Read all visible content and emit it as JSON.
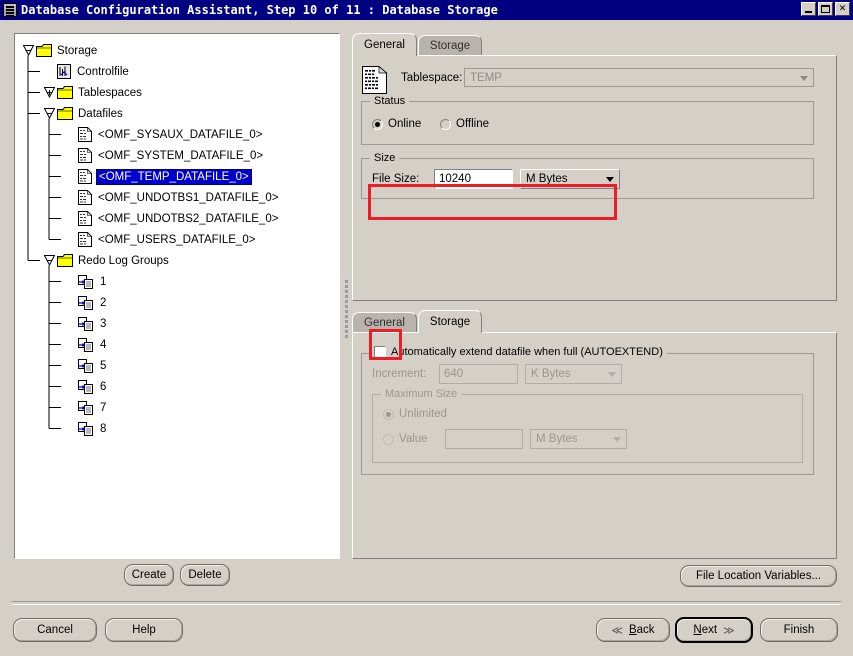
{
  "window": {
    "title": "Database Configuration Assistant, Step 10 of 11 : Database Storage",
    "icon": "database-icon",
    "minimize_label": "_",
    "maximize_label": "",
    "close_label": "✕"
  },
  "tree": {
    "nodes": [
      {
        "label": "Storage",
        "depth": 0,
        "icon": "folder-icon",
        "toggle": "minus",
        "selected": false
      },
      {
        "label": "Controlfile",
        "depth": 1,
        "icon": "controlfile-icon",
        "toggle": "none",
        "selected": false
      },
      {
        "label": "Tablespaces",
        "depth": 1,
        "icon": "folder-icon",
        "toggle": "plus",
        "selected": false
      },
      {
        "label": "Datafiles",
        "depth": 1,
        "icon": "folder-icon",
        "toggle": "minus",
        "selected": false
      },
      {
        "label": "<OMF_SYSAUX_DATAFILE_0>",
        "depth": 2,
        "icon": "datafile-icon",
        "toggle": "none",
        "selected": false
      },
      {
        "label": "<OMF_SYSTEM_DATAFILE_0>",
        "depth": 2,
        "icon": "datafile-icon",
        "toggle": "none",
        "selected": false
      },
      {
        "label": "<OMF_TEMP_DATAFILE_0>",
        "depth": 2,
        "icon": "datafile-icon",
        "toggle": "none",
        "selected": true
      },
      {
        "label": "<OMF_UNDOTBS1_DATAFILE_0>",
        "depth": 2,
        "icon": "datafile-icon",
        "toggle": "none",
        "selected": false
      },
      {
        "label": "<OMF_UNDOTBS2_DATAFILE_0>",
        "depth": 2,
        "icon": "datafile-icon",
        "toggle": "none",
        "selected": false
      },
      {
        "label": "<OMF_USERS_DATAFILE_0>",
        "depth": 2,
        "icon": "datafile-icon",
        "toggle": "none",
        "selected": false
      },
      {
        "label": "Redo Log Groups",
        "depth": 1,
        "icon": "folder-icon",
        "toggle": "minus",
        "selected": false
      },
      {
        "label": "1",
        "depth": 2,
        "icon": "redolog-icon",
        "toggle": "none",
        "selected": false
      },
      {
        "label": "2",
        "depth": 2,
        "icon": "redolog-icon",
        "toggle": "none",
        "selected": false
      },
      {
        "label": "3",
        "depth": 2,
        "icon": "redolog-icon",
        "toggle": "none",
        "selected": false
      },
      {
        "label": "4",
        "depth": 2,
        "icon": "redolog-icon",
        "toggle": "none",
        "selected": false
      },
      {
        "label": "5",
        "depth": 2,
        "icon": "redolog-icon",
        "toggle": "none",
        "selected": false
      },
      {
        "label": "6",
        "depth": 2,
        "icon": "redolog-icon",
        "toggle": "none",
        "selected": false
      },
      {
        "label": "7",
        "depth": 2,
        "icon": "redolog-icon",
        "toggle": "none",
        "selected": false
      },
      {
        "label": "8",
        "depth": 2,
        "icon": "redolog-icon",
        "toggle": "none",
        "selected": false
      }
    ]
  },
  "tree_actions": {
    "create_label": "Create",
    "delete_label": "Delete"
  },
  "top_panel": {
    "tabs": [
      {
        "label": "General",
        "active": true
      },
      {
        "label": "Storage",
        "active": false
      }
    ],
    "tablespace_label": "Tablespace:",
    "tablespace_value": "TEMP",
    "status_group": "Status",
    "online_label": "Online",
    "offline_label": "Offline",
    "status_selected": "Online",
    "size_group": "Size",
    "file_size_label": "File Size:",
    "file_size_value": "10240",
    "file_size_unit": "M Bytes"
  },
  "bottom_panel": {
    "tabs": [
      {
        "label": "General",
        "active": false
      },
      {
        "label": "Storage",
        "active": true
      }
    ],
    "autoextend_label": "Automatically extend datafile when full (AUTOEXTEND)",
    "autoextend_checked": false,
    "increment_label": "Increment:",
    "increment_value": "640",
    "increment_unit": "K Bytes",
    "max_size_group": "Maximum Size",
    "unlimited_label": "Unlimited",
    "value_label": "Value",
    "value_value": "",
    "value_unit": "M Bytes",
    "max_size_selected": "Unlimited"
  },
  "file_location_button": "File Location Variables...",
  "nav": {
    "cancel_label": "Cancel",
    "help_label": "Help",
    "back_label": "Back",
    "back_mnemonic": "B",
    "next_label": "Next",
    "next_mnemonic": "N",
    "finish_label": "Finish",
    "back_icon": "chevron-left-icon",
    "next_icon": "chevron-right-icon"
  },
  "colors": {
    "titlebar": "#000080",
    "face": "#d4d0c8",
    "selection": "#0000cc",
    "highlight_box": "#ee1c25"
  }
}
